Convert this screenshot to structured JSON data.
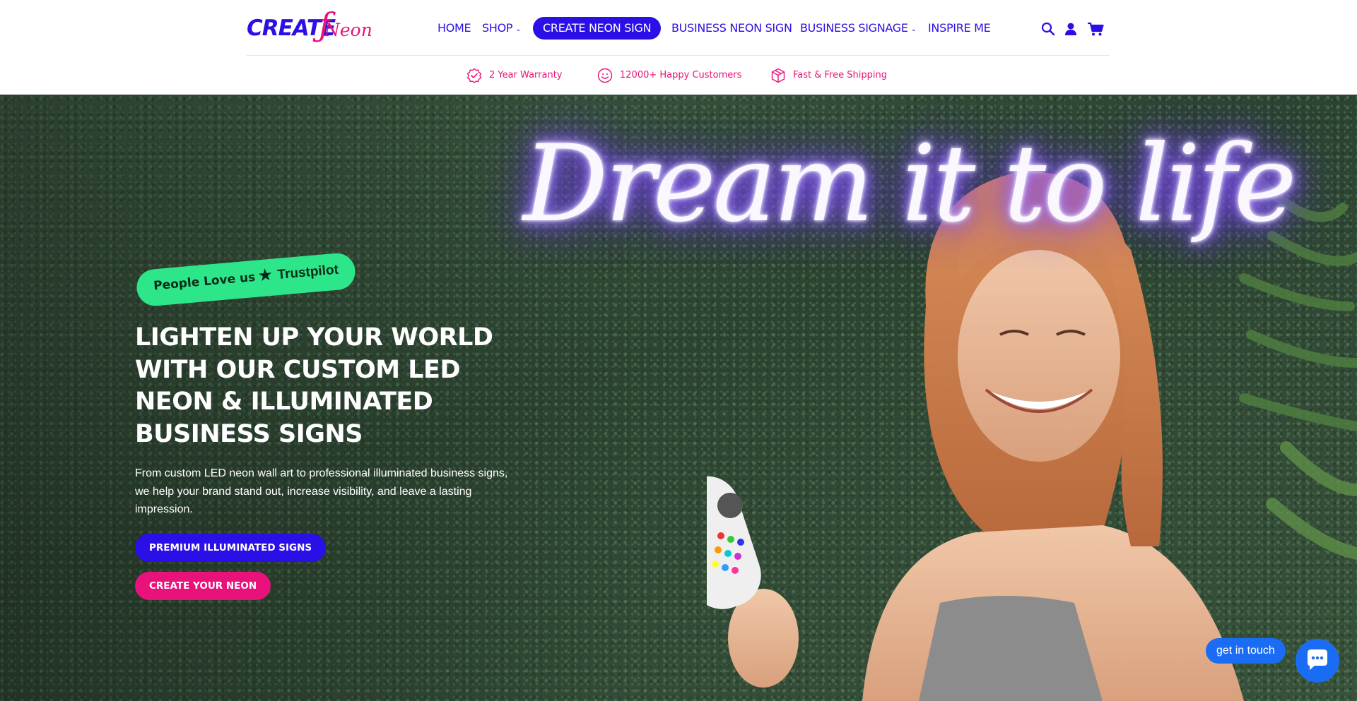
{
  "brand": {
    "logo_main": "CREATE",
    "logo_script": "Neon"
  },
  "nav": {
    "items": [
      {
        "label": "HOME",
        "dropdown": false
      },
      {
        "label": "SHOP",
        "dropdown": true
      },
      {
        "label": "CREATE NEON SIGN",
        "highlighted": true
      },
      {
        "label": "BUSINESS NEON SIGN",
        "dropdown": false
      },
      {
        "label": "BUSINESS SIGNAGE",
        "dropdown": true
      },
      {
        "label": "INSPIRE ME",
        "dropdown": false
      }
    ],
    "icons": [
      "search-icon",
      "account-icon",
      "cart-icon"
    ]
  },
  "usps": [
    {
      "icon": "warranty-badge-icon",
      "label": "2 Year Warranty"
    },
    {
      "icon": "smiley-icon",
      "label": "12000+ Happy Customers"
    },
    {
      "icon": "box-icon",
      "label": "Fast & Free Shipping"
    }
  ],
  "hero": {
    "neon_text": "Dream it to life",
    "trust_badge": {
      "text": "People Love us",
      "brand": "Trustpilot"
    },
    "title": "LIGHTEN UP YOUR WORLD WITH OUR CUSTOM LED NEON & ILLUMINATED BUSINESS SIGNS",
    "description": "From custom LED neon wall art to professional illuminated business signs, we help your brand stand out, increase visibility, and leave a lasting impression.",
    "buttons": {
      "primary": "PREMIUM ILLUMINATED SIGNS",
      "secondary": "CREATE YOUR NEON"
    }
  },
  "chat": {
    "label": "get in touch"
  },
  "colors": {
    "brand_blue": "#2a0fe6",
    "brand_pink": "#e8127a",
    "trustpilot_green": "#2ee68a",
    "chat_blue": "#1a6cf5"
  }
}
